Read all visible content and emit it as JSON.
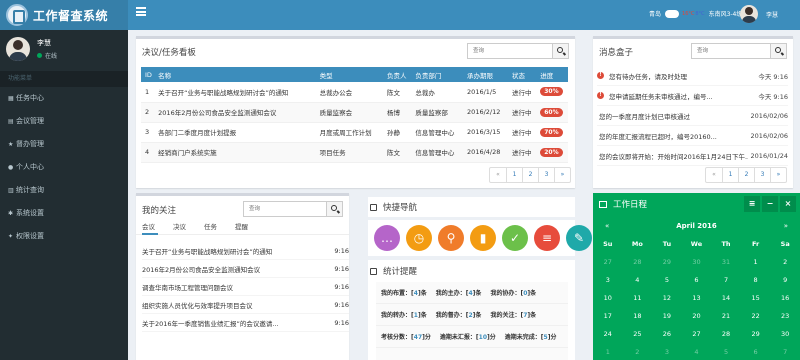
{
  "app": {
    "title": "工作督查系统"
  },
  "sidebar": {
    "user_name": "李慧",
    "status": "在线",
    "menu_header": "功能菜单",
    "items": [
      {
        "icon": "list-icon",
        "label": "任务中心"
      },
      {
        "icon": "doc-icon",
        "label": "会议管理"
      },
      {
        "icon": "star-icon",
        "label": "督办管理"
      },
      {
        "icon": "user-icon",
        "label": "个人中心"
      },
      {
        "icon": "chart-icon",
        "label": "统计查询"
      },
      {
        "icon": "gear-icon",
        "label": "系统设置"
      },
      {
        "icon": "key-icon",
        "label": "权限设置"
      }
    ]
  },
  "topbar": {
    "weather_city": "青岛",
    "weather_temp_high": "16°C",
    "weather_temp_low": "8°C",
    "weather_wind": "东南风3-4级",
    "user_name": "李慧"
  },
  "taskboard": {
    "title": "决议/任务看板",
    "search_placeholder": "查询",
    "columns": [
      "ID",
      "名称",
      "类型",
      "负责人",
      "负责部门",
      "承办期限",
      "状态",
      "进度"
    ],
    "rows": [
      {
        "id": "1",
        "name": "关于召开“业务与职能战略规划研讨会”的通知",
        "type": "总裁办公会",
        "owner": "陈文",
        "dept": "总裁办",
        "deadline": "2016/1/5",
        "status": "进行中",
        "progress": "30%"
      },
      {
        "id": "2",
        "name": "2016年2月份公司食品安全监测通知会议",
        "type": "质量监察会",
        "owner": "杨博",
        "dept": "质量监察部",
        "deadline": "2016/2/12",
        "status": "进行中",
        "progress": "60%"
      },
      {
        "id": "3",
        "name": "各部门二季度月度计划提报",
        "type": "月度或周工作计划",
        "owner": "孙静",
        "dept": "信息管理中心",
        "deadline": "2016/3/15",
        "status": "进行中",
        "progress": "70%"
      },
      {
        "id": "4",
        "name": "经销商门户系统实施",
        "type": "项目任务",
        "owner": "陈文",
        "dept": "信息管理中心",
        "deadline": "2016/4/28",
        "status": "进行中",
        "progress": "20%"
      }
    ],
    "pager": [
      "«",
      "1",
      "2",
      "3",
      "»"
    ]
  },
  "messages": {
    "title": "消息盒子",
    "search_placeholder": "查询",
    "items": [
      {
        "warn": true,
        "text": "您有待办任务，请及时处理",
        "date": "今天 9:16"
      },
      {
        "warn": true,
        "text": "您申请延期任务未审核通过，编号...",
        "date": "今天 9:16"
      },
      {
        "warn": false,
        "text": "您的一季度月度计划已审核通过",
        "date": "2016/02/06"
      },
      {
        "warn": false,
        "text": "您的年度汇报流程已超时，编号20160...",
        "date": "2016/02/06"
      },
      {
        "warn": false,
        "text": "您的会议即将开始：开始时间2016年1月24日下午...",
        "date": "2016/01/24"
      }
    ],
    "pager": [
      "«",
      "1",
      "2",
      "3",
      "»"
    ]
  },
  "follow": {
    "title": "我的关注",
    "search_placeholder": "查询",
    "tabs": [
      "会议",
      "决议",
      "任务",
      "提醒"
    ],
    "items": [
      {
        "text": "关于召开“业务与职能战略规划研讨会”的通知",
        "time": "9:16"
      },
      {
        "text": "2016年2月份公司食品安全监测通知会议",
        "time": "9:16"
      },
      {
        "text": "调查华南市场工程管理问题会议",
        "time": "9:16"
      },
      {
        "text": "组织实施人员优化与效率提升项目会议",
        "time": "9:16"
      },
      {
        "text": "关于2016年一季度销售业绩汇报”的会议邀请...",
        "time": "9:16"
      }
    ]
  },
  "shortcuts": {
    "title": "快捷导航",
    "icons": [
      {
        "name": "chat-icon",
        "color": "#b565c9",
        "glyph": "…"
      },
      {
        "name": "alarm-icon",
        "color": "#f39c12",
        "glyph": "◷"
      },
      {
        "name": "location-icon",
        "color": "#f07c2a",
        "glyph": "⚲"
      },
      {
        "name": "bar-chart-icon",
        "color": "#f39c12",
        "glyph": "▮"
      },
      {
        "name": "calendar-check-icon",
        "color": "#6cc04a",
        "glyph": "✓"
      },
      {
        "name": "checklist-icon",
        "color": "#e74c3c",
        "glyph": "≡"
      },
      {
        "name": "report-icon",
        "color": "#1fa9a9",
        "glyph": "✎"
      }
    ]
  },
  "stats": {
    "title": "统计提醒",
    "rows": [
      [
        {
          "label": "我的布置：",
          "n": "4",
          "unit": "条"
        },
        {
          "label": "我的主办：",
          "n": "4",
          "unit": "条"
        },
        {
          "label": "我的协办：",
          "n": "0",
          "unit": "条"
        }
      ],
      [
        {
          "label": "我的转办：",
          "n": "1",
          "unit": "条"
        },
        {
          "label": "我的督办：",
          "n": "2",
          "unit": "条"
        },
        {
          "label": "我的关注：",
          "n": "7",
          "unit": "条"
        }
      ],
      [
        {
          "label": "考核分数：",
          "n": "47",
          "unit": "分"
        },
        {
          "label": "逾期未汇报：",
          "n": "10",
          "unit": "分"
        },
        {
          "label": "逾期未完成：",
          "n": "5",
          "unit": "分"
        }
      ]
    ]
  },
  "calendar": {
    "title": "工作日程",
    "month": "April 2016",
    "prev": "«",
    "next": "»",
    "dow": [
      "Su",
      "Mo",
      "Tu",
      "We",
      "Th",
      "Fr",
      "Sa"
    ],
    "weeks": [
      [
        {
          "d": "27",
          "om": true
        },
        {
          "d": "28",
          "om": true
        },
        {
          "d": "29",
          "om": true
        },
        {
          "d": "30",
          "om": true
        },
        {
          "d": "31",
          "om": true
        },
        {
          "d": "1"
        },
        {
          "d": "2"
        }
      ],
      [
        {
          "d": "3"
        },
        {
          "d": "4"
        },
        {
          "d": "5"
        },
        {
          "d": "6"
        },
        {
          "d": "7"
        },
        {
          "d": "8"
        },
        {
          "d": "9"
        }
      ],
      [
        {
          "d": "10"
        },
        {
          "d": "11"
        },
        {
          "d": "12"
        },
        {
          "d": "13"
        },
        {
          "d": "14"
        },
        {
          "d": "15"
        },
        {
          "d": "16"
        }
      ],
      [
        {
          "d": "17"
        },
        {
          "d": "18"
        },
        {
          "d": "19"
        },
        {
          "d": "20"
        },
        {
          "d": "21"
        },
        {
          "d": "22"
        },
        {
          "d": "23"
        }
      ],
      [
        {
          "d": "24"
        },
        {
          "d": "25"
        },
        {
          "d": "26"
        },
        {
          "d": "27"
        },
        {
          "d": "28"
        },
        {
          "d": "29"
        },
        {
          "d": "30"
        }
      ],
      [
        {
          "d": "1",
          "om": true
        },
        {
          "d": "2",
          "om": true
        },
        {
          "d": "3",
          "om": true
        },
        {
          "d": "4",
          "om": true
        },
        {
          "d": "5",
          "om": true
        },
        {
          "d": "6",
          "om": true
        },
        {
          "d": "7",
          "om": true
        }
      ]
    ],
    "tools": [
      "≡",
      "−",
      "×"
    ]
  }
}
